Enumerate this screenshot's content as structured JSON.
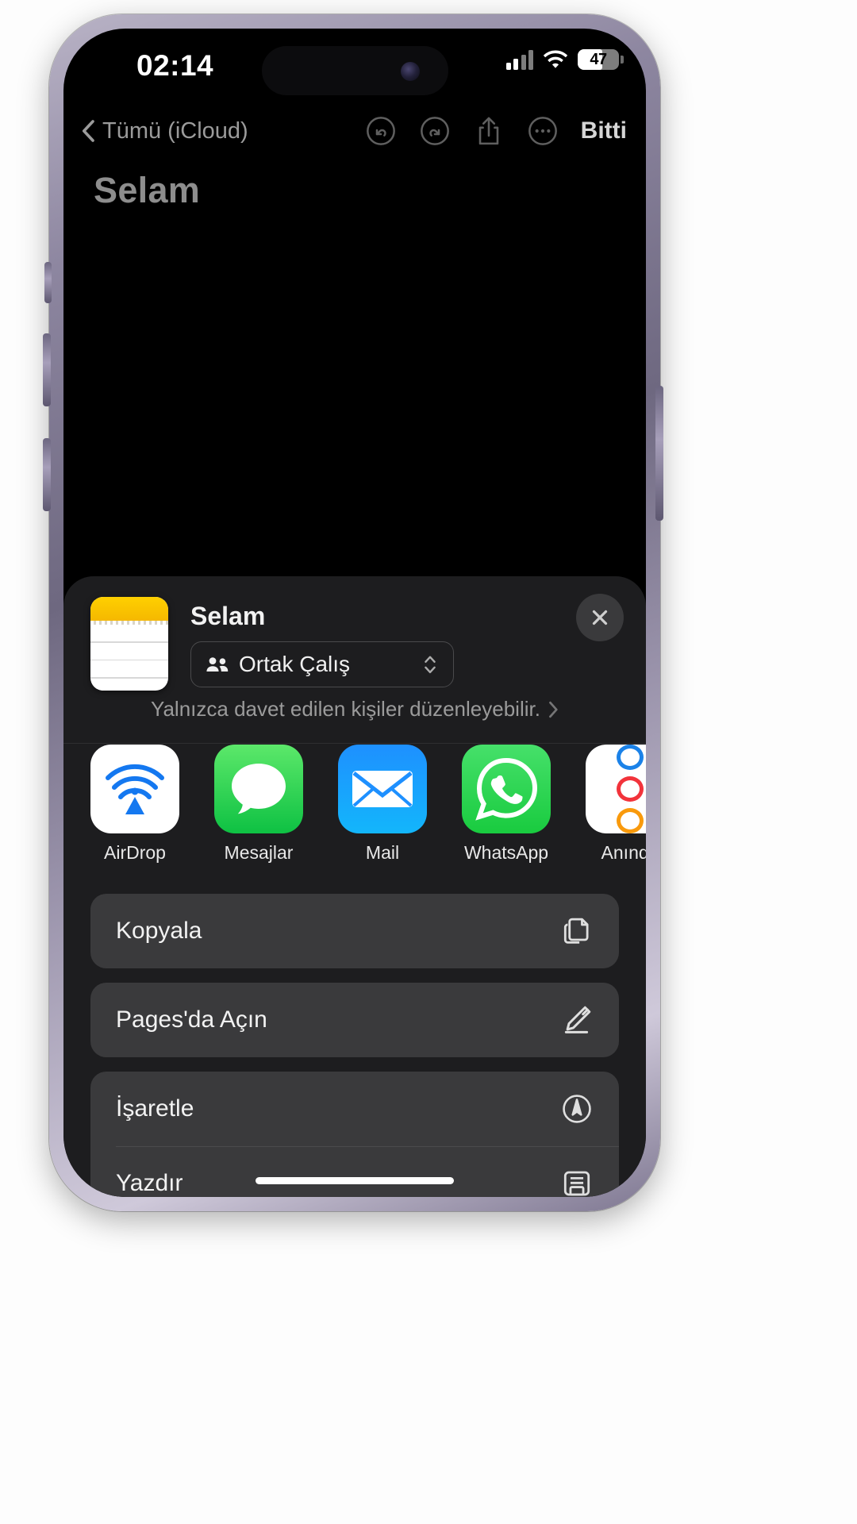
{
  "status_bar": {
    "time": "02:14",
    "silent_icon": "bell-slash-icon",
    "battery_level": "47",
    "cellular_icon": "signal-bars-icon",
    "wifi_icon": "wifi-icon"
  },
  "nav_bar": {
    "back_label": "Tümü (iCloud)",
    "back_icon": "chevron-left-icon",
    "undo_icon": "undo-icon",
    "redo_icon": "redo-icon",
    "share_icon": "share-icon",
    "more_icon": "ellipsis-circle-icon",
    "done_label": "Bitti"
  },
  "note": {
    "title": "Selam",
    "body": ""
  },
  "share_sheet": {
    "title": "Selam",
    "thumbnail_icon": "notes-document-icon",
    "collaboration": {
      "label": "Ortak Çalış",
      "people_icon": "people-icon",
      "chevrons_icon": "chevron-up-down-icon"
    },
    "permission": {
      "text": "Yalnızca davet edilen kişiler düzenleyebilir.",
      "chevron_icon": "chevron-right-icon"
    },
    "close_icon": "close-icon",
    "apps": [
      {
        "label": "AirDrop",
        "icon": "airdrop-icon"
      },
      {
        "label": "Mesajlar",
        "icon": "messages-icon"
      },
      {
        "label": "Mail",
        "icon": "mail-icon"
      },
      {
        "label": "WhatsApp",
        "icon": "whatsapp-icon"
      },
      {
        "label": "Anında",
        "icon": "instant-note-icon"
      }
    ],
    "action_groups": [
      {
        "rows": [
          {
            "label": "Kopyala",
            "icon": "copy-icon"
          }
        ]
      },
      {
        "rows": [
          {
            "label": "Pages'da Açın",
            "icon": "pencil-icon"
          }
        ]
      },
      {
        "rows": [
          {
            "label": "İşaretle",
            "icon": "markup-icon"
          },
          {
            "label": "Yazdır",
            "icon": "printer-icon"
          }
        ]
      }
    ]
  },
  "colors": {
    "sheet_background": "#1d1d1f",
    "card_background": "#3a3a3c",
    "accent_yellow": "#ffd000",
    "messages_green": "#0ec143",
    "mail_blue": "#1e90ff",
    "whatsapp_green": "#19cb3f",
    "instant_blue": "#1b82e8",
    "instant_red": "#f2333b",
    "instant_orange": "#f99a0c"
  }
}
